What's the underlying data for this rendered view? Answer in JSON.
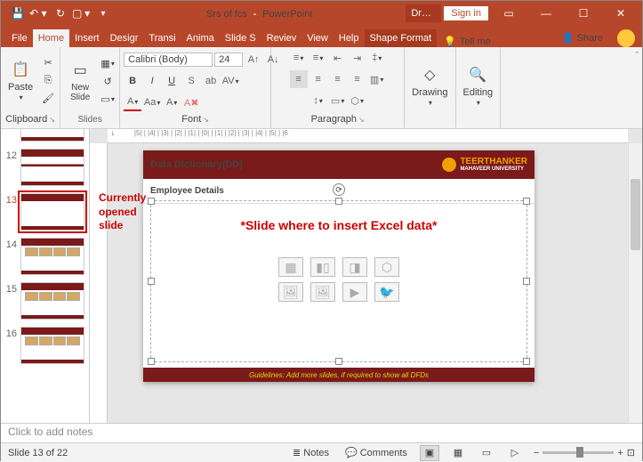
{
  "titlebar": {
    "doc_title": "Srs of fcs",
    "app_name": "PowerPoint",
    "draw_tab": "Drawi...",
    "sign_in": "Sign in"
  },
  "tabs": {
    "file": "File",
    "home": "Home",
    "insert": "Insert",
    "design": "Desigr",
    "transitions": "Transi",
    "animations": "Anima",
    "slideshow": "Slide S",
    "review": "Reviev",
    "view": "View",
    "help": "Help",
    "shape_format": "Shape Format",
    "tell_me": "Tell me",
    "share": "Share"
  },
  "ribbon": {
    "clipboard": {
      "label": "Clipboard",
      "paste": "Paste"
    },
    "slides": {
      "label": "Slides",
      "new_slide": "New\nSlide"
    },
    "font": {
      "label": "Font",
      "family": "Calibri (Body)",
      "size": "24"
    },
    "paragraph": {
      "label": "Paragraph"
    },
    "drawing": {
      "label": "Drawing"
    },
    "editing": {
      "label": "Editing"
    }
  },
  "thumbs": [
    {
      "num": "12"
    },
    {
      "num": "13"
    },
    {
      "num": "14"
    },
    {
      "num": "15"
    },
    {
      "num": "16"
    }
  ],
  "annotation": "Currently\nopened\nslide",
  "slide": {
    "title": "Data Dictionary(DD)",
    "logo_line1": "TEERTHANKER",
    "logo_line2": "MAHAVEER UNIVERSITY",
    "subtitle": "Employee Details",
    "red_text": "*Slide where to insert Excel data*",
    "footer": "Guidelines: Add more slides, if required to show all DFDs"
  },
  "notes": {
    "placeholder": "Click to add notes"
  },
  "status": {
    "slide_info": "Slide 13 of 22",
    "notes": "Notes",
    "comments": "Comments",
    "zoom": "– – – – –"
  }
}
